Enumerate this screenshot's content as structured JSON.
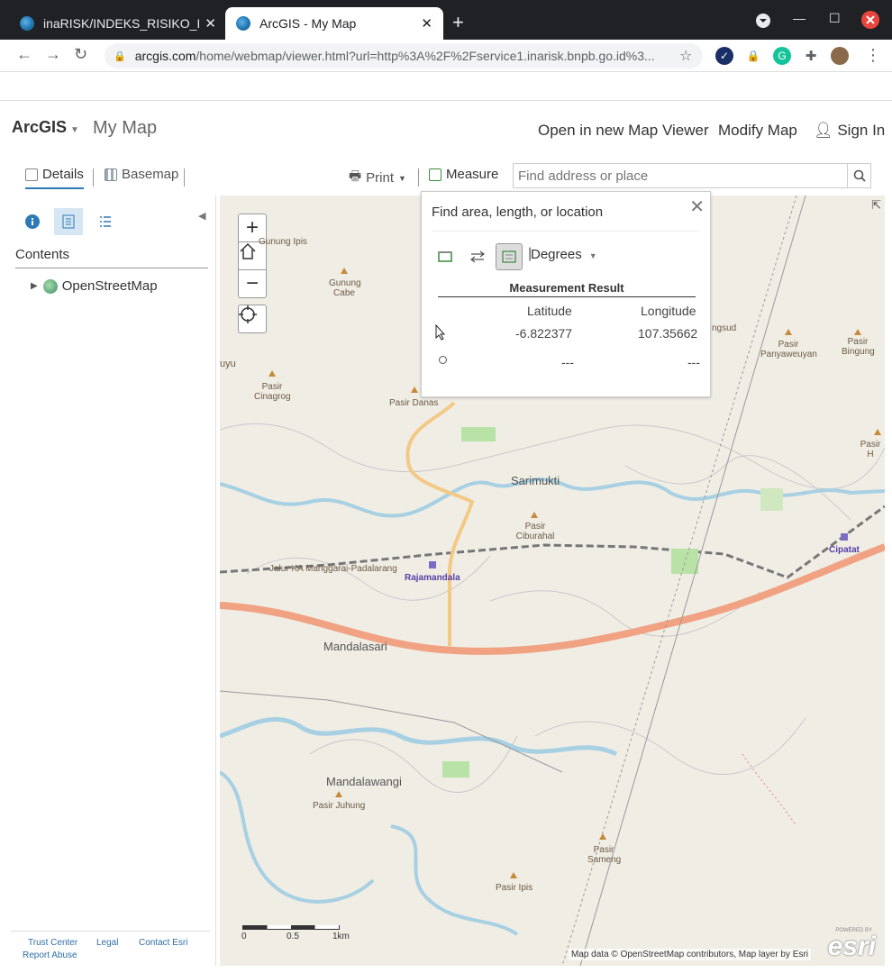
{
  "browser": {
    "tabs": [
      {
        "title": "inaRISK/INDEKS_RISIKO_I",
        "close": "✕"
      },
      {
        "title": "ArcGIS - My Map",
        "close": "✕"
      }
    ],
    "new_tab": "+",
    "url_domain": "arcgis.com",
    "url_rest": "/home/webmap/viewer.html?url=http%3A%2F%2Fservice1.inarisk.bnpb.go.id%3..."
  },
  "header": {
    "logo": "ArcGIS",
    "map_title": "My Map",
    "open_new_viewer": "Open in new Map Viewer",
    "modify_map": "Modify Map",
    "sign_in": "Sign In"
  },
  "toolbar": {
    "details": "Details",
    "basemap": "Basemap",
    "print": "Print",
    "measure": "Measure",
    "search_placeholder": "Find address or place"
  },
  "sidebar": {
    "contents_label": "Contents",
    "layers": [
      {
        "name": "OpenStreetMap"
      }
    ],
    "footer": {
      "trust": "Trust Center",
      "legal": "Legal",
      "contact": "Contact Esri",
      "report": "Report Abuse"
    }
  },
  "measure_panel": {
    "title": "Find area, length, or location",
    "unit": "Degrees",
    "result_heading": "Measurement Result",
    "col_latitude": "Latitude",
    "col_longitude": "Longitude",
    "row1": {
      "lat": "-6.822377",
      "lon": "107.35662"
    },
    "row2": {
      "lat": "---",
      "lon": "---"
    }
  },
  "map": {
    "scale": {
      "s0": "0",
      "s1": "0.5",
      "s2": "1km"
    },
    "attribution": "Map data © OpenStreetMap contributors, Map layer by Esri",
    "esri_small": "POWERED BY",
    "esri": "esri",
    "labels": {
      "gunung_ipis": "Gunung Ipis",
      "gunung_cabe": "Gunung Cabe",
      "uyu": "uyu",
      "pasir_cinagrog": "Pasir Cinagrog",
      "pasir_danas": "Pasir Danas",
      "sarimukti": "Sarimukti",
      "pasir_ciburahal": "Pasir Ciburahal",
      "rajamandala": "Rajamandala",
      "jalur_ka": "Jalur KA Manggarai-Padalarang",
      "mandalasari": "Mandalasari",
      "mandalawangi": "Mandalawangi",
      "pasir_juhung": "Pasir Juhung",
      "pasir_sameng": "Pasir Sameng",
      "pasir_ipis": "Pasir Ipis",
      "cipatat": "Cipatat",
      "pasir_panyaweuyan": "Pasir Panyaweuyan",
      "pasir_bingung": "Pasir Bingung",
      "pasir_h": "Pasir H",
      "ngsud": "ngsud"
    }
  }
}
